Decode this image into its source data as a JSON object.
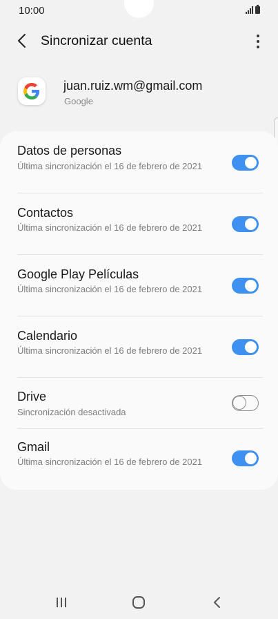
{
  "status_bar": {
    "time": "10:00"
  },
  "header": {
    "title": "Sincronizar cuenta"
  },
  "account": {
    "email": "juan.ruiz.wm@gmail.com",
    "type": "Google"
  },
  "sync_items": [
    {
      "title": "Datos de personas",
      "subtitle": "Última sincronización el 16 de febrero de 2021",
      "enabled": true
    },
    {
      "title": "Contactos",
      "subtitle": "Última sincronización el 16 de febrero de 2021",
      "enabled": true
    },
    {
      "title": "Google Play Películas",
      "subtitle": "Última sincronización el 16 de febrero de 2021",
      "enabled": true
    },
    {
      "title": "Calendario",
      "subtitle": "Última sincronización el 16 de febrero de 2021",
      "enabled": true
    },
    {
      "title": "Drive",
      "subtitle": "Sincronización desactivada",
      "enabled": false
    },
    {
      "title": "Gmail",
      "subtitle": "Última sincronización el 16 de febrero de 2021",
      "enabled": true
    }
  ],
  "colors": {
    "accent": "#3e91f1",
    "background": "#f2f2f2",
    "card": "#fafafa"
  },
  "icons": {
    "back": "chevron-left-icon",
    "more": "more-vert-icon",
    "logo": "google-logo-icon",
    "nav_recents": "recents-icon",
    "nav_home": "home-icon",
    "nav_back": "back-icon"
  }
}
